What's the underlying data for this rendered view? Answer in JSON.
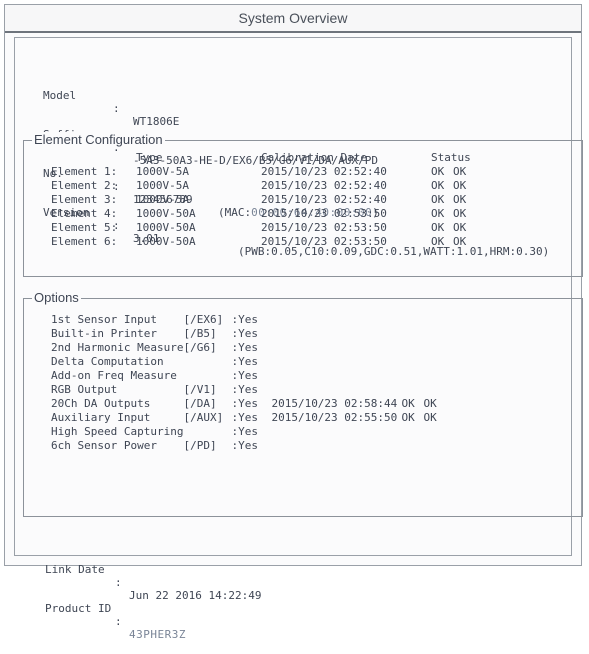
{
  "window": {
    "title": "System Overview"
  },
  "system": {
    "model": {
      "label": "Model",
      "colon": ":",
      "value": "WT1806E"
    },
    "suffix": {
      "label": "Suffix",
      "colon": ":",
      "value": "-5A3-50A3-HE-D/EX6/B5/G6/V1/DA/AUX/PD"
    },
    "no": {
      "label": "No.",
      "colon": ":",
      "value": "123456789",
      "mac_prefix": "(MAC:",
      "mac_value": "00:00:64:40:00:00",
      "mac_suffix": ")"
    },
    "version": {
      "label": "Version",
      "colon": ":",
      "value": "3.01",
      "details": "(PWB:0.05,C10:0.09,GDC:0.51,WATT:1.01,HRM:0.30)"
    }
  },
  "element_configuration": {
    "title": "Element Configuration",
    "headers": {
      "type": "Type",
      "calibration": "Calibration Date",
      "status": "Status"
    },
    "rows": [
      {
        "name": "Element 1:",
        "type": "1000V-5A",
        "date": "2015/10/23 02:52:40",
        "s1": "OK",
        "s2": "OK"
      },
      {
        "name": "Element 2:",
        "type": "1000V-5A",
        "date": "2015/10/23 02:52:40",
        "s1": "OK",
        "s2": "OK"
      },
      {
        "name": "Element 3:",
        "type": "1000V-5A",
        "date": "2015/10/23 02:52:40",
        "s1": "OK",
        "s2": "OK"
      },
      {
        "name": "Element 4:",
        "type": "1000V-50A",
        "date": "2015/10/23 02:53:50",
        "s1": "OK",
        "s2": "OK"
      },
      {
        "name": "Element 5:",
        "type": "1000V-50A",
        "date": "2015/10/23 02:53:50",
        "s1": "OK",
        "s2": "OK"
      },
      {
        "name": "Element 6:",
        "type": "1000V-50A",
        "date": "2015/10/23 02:53:50",
        "s1": "OK",
        "s2": "OK"
      }
    ]
  },
  "options": {
    "title": "Options",
    "rows": [
      {
        "name": "1st Sensor Input",
        "code": "[/EX6]",
        "value": ":Yes",
        "date": "",
        "s1": "",
        "s2": ""
      },
      {
        "name": "Built-in Printer",
        "code": "[/B5]",
        "value": ":Yes",
        "date": "",
        "s1": "",
        "s2": ""
      },
      {
        "name": "2nd Harmonic Measure",
        "code": "[/G6]",
        "value": ":Yes",
        "date": "",
        "s1": "",
        "s2": ""
      },
      {
        "name": "Delta Computation",
        "code": "",
        "value": ":Yes",
        "date": "",
        "s1": "",
        "s2": ""
      },
      {
        "name": "Add-on Freq Measure",
        "code": "",
        "value": ":Yes",
        "date": "",
        "s1": "",
        "s2": ""
      },
      {
        "name": "RGB Output",
        "code": "[/V1]",
        "value": ":Yes",
        "date": "",
        "s1": "",
        "s2": ""
      },
      {
        "name": "20Ch DA Outputs",
        "code": "[/DA]",
        "value": ":Yes",
        "date": "2015/10/23 02:58:44",
        "s1": "OK",
        "s2": "OK"
      },
      {
        "name": "Auxiliary Input",
        "code": "[/AUX]",
        "value": ":Yes",
        "date": "2015/10/23 02:55:50",
        "s1": "OK",
        "s2": "OK"
      },
      {
        "name": "High Speed Capturing",
        "code": "",
        "value": ":Yes",
        "date": "",
        "s1": "",
        "s2": ""
      },
      {
        "name": "6ch Sensor Power",
        "code": "[/PD]",
        "value": ":Yes",
        "date": "",
        "s1": "",
        "s2": ""
      }
    ]
  },
  "footer": {
    "link_date": {
      "label": "Link Date",
      "colon": ":",
      "value": "Jun 22 2016 14:22:49"
    },
    "product_id": {
      "label": "Product ID",
      "colon": ":",
      "value": "43PHER3Z"
    }
  }
}
